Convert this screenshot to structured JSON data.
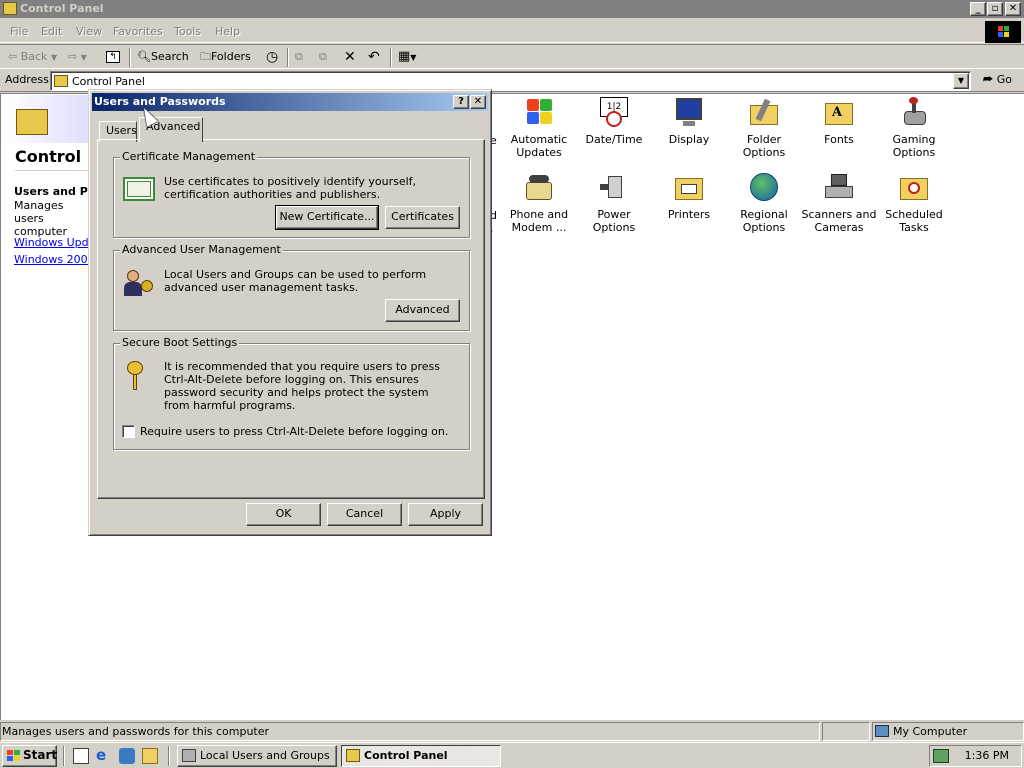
{
  "window": {
    "title": "Control Panel",
    "caption_buttons": {
      "minimize": "_",
      "maximize": "▫",
      "close": "✕"
    }
  },
  "menubar": [
    "File",
    "Edit",
    "View",
    "Favorites",
    "Tools",
    "Help"
  ],
  "toolbar": {
    "back": "Back",
    "search": "Search",
    "folders": "Folders"
  },
  "address": {
    "label": "Address",
    "value": "Control Panel",
    "go": "Go"
  },
  "left_pane": {
    "title": "Control P",
    "selected_name": "Users and Pas",
    "selected_desc": "Manages users computer",
    "links": [
      "Windows Updat",
      "Windows 2000 S"
    ]
  },
  "items": [
    {
      "label": "Automatic Updates",
      "icon": "automatic-updates-icon"
    },
    {
      "label": "Date/Time",
      "icon": "date-time-icon"
    },
    {
      "label": "Display",
      "icon": "display-icon"
    },
    {
      "label": "Folder Options",
      "icon": "folder-options-icon"
    },
    {
      "label": "Fonts",
      "icon": "fonts-icon"
    },
    {
      "label": "Gaming Options",
      "icon": "gaming-options-icon"
    },
    {
      "label": "Phone and Modem ...",
      "icon": "phone-modem-icon"
    },
    {
      "label": "Power Options",
      "icon": "power-options-icon"
    },
    {
      "label": "Printers",
      "icon": "printers-icon"
    },
    {
      "label": "Regional Options",
      "icon": "regional-options-icon"
    },
    {
      "label": "Scanners and Cameras",
      "icon": "scanners-cameras-icon"
    },
    {
      "label": "Scheduled Tasks",
      "icon": "scheduled-tasks-icon"
    }
  ],
  "partial_labels": [
    "e",
    "d",
    "."
  ],
  "statusbar": {
    "text": "Manages users and passwords for this computer",
    "zone": "My Computer"
  },
  "taskbar": {
    "start": "Start",
    "buttons": [
      "Local Users and Groups",
      "Control Panel"
    ],
    "clock": "1:36 PM"
  },
  "dialog": {
    "title": "Users and Passwords",
    "help": "?",
    "close": "✕",
    "tabs": [
      "Users",
      "Advanced"
    ],
    "cert": {
      "title": "Certificate Management",
      "text": "Use certificates to positively identify yourself, certification authorities and publishers.",
      "new_cert": "New Certificate...",
      "certificates": "Certificates"
    },
    "aum": {
      "title": "Advanced User Management",
      "text": "Local Users and Groups can be used to perform advanced user management tasks.",
      "advanced": "Advanced"
    },
    "boot": {
      "title": "Secure Boot Settings",
      "text": "It is recommended that you require users to press Ctrl-Alt-Delete before logging on. This ensures password security and helps protect the system from harmful programs.",
      "checkbox_label": "Require users to press Ctrl-Alt-Delete before logging on.",
      "checked": false
    },
    "ok": "OK",
    "cancel": "Cancel",
    "apply": "Apply"
  }
}
